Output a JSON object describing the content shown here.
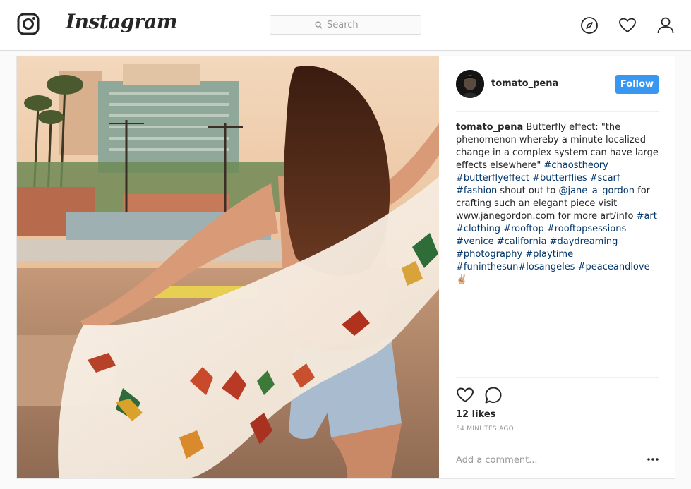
{
  "nav": {
    "brand": "Instagram",
    "search_placeholder": "Search",
    "icons": [
      "instagram-logo-icon",
      "explore-compass-icon",
      "activity-heart-icon",
      "profile-person-icon"
    ]
  },
  "post": {
    "author": "tomato_pena",
    "follow_label": "Follow",
    "caption_username": "tomato_pena",
    "caption_parts": [
      {
        "t": " Butterfly effect: \"the phenomenon whereby a minute localized change in a complex system can have large effects elsewhere\" ",
        "k": "text"
      },
      {
        "t": "#chaostheory",
        "k": "tag"
      },
      {
        "t": " ",
        "k": "text"
      },
      {
        "t": "#butterflyeffect",
        "k": "tag"
      },
      {
        "t": " ",
        "k": "text"
      },
      {
        "t": "#butterflies",
        "k": "tag"
      },
      {
        "t": " ",
        "k": "text"
      },
      {
        "t": "#scarf",
        "k": "tag"
      },
      {
        "t": " ",
        "k": "text"
      },
      {
        "t": "#fashion",
        "k": "tag"
      },
      {
        "t": " shout out to ",
        "k": "text"
      },
      {
        "t": "@jane_a_gordon",
        "k": "tag"
      },
      {
        "t": " for crafting such an elegant piece visit www.janegordon.com for more art/info ",
        "k": "text"
      },
      {
        "t": "#art",
        "k": "tag"
      },
      {
        "t": " ",
        "k": "text"
      },
      {
        "t": "#clothing",
        "k": "tag"
      },
      {
        "t": " ",
        "k": "text"
      },
      {
        "t": "#rooftop",
        "k": "tag"
      },
      {
        "t": " ",
        "k": "text"
      },
      {
        "t": "#rooftopsessions",
        "k": "tag"
      },
      {
        "t": " ",
        "k": "text"
      },
      {
        "t": "#venice",
        "k": "tag"
      },
      {
        "t": " ",
        "k": "text"
      },
      {
        "t": "#california",
        "k": "tag"
      },
      {
        "t": " ",
        "k": "text"
      },
      {
        "t": "#daydreaming",
        "k": "tag"
      },
      {
        "t": " ",
        "k": "text"
      },
      {
        "t": "#photography",
        "k": "tag"
      },
      {
        "t": " ",
        "k": "text"
      },
      {
        "t": "#playtime",
        "k": "tag"
      },
      {
        "t": " ",
        "k": "text"
      },
      {
        "t": "#funinthesun",
        "k": "tag"
      },
      {
        "t": "#losangeles",
        "k": "tag"
      },
      {
        "t": " ",
        "k": "text"
      },
      {
        "t": "#peaceandlove",
        "k": "tag"
      },
      {
        "t": " ✌🏼",
        "k": "text"
      }
    ],
    "likes": "12 likes",
    "timestamp": "54 MINUTES AGO",
    "comment_placeholder": "Add a comment...",
    "icons": [
      "like-heart-icon",
      "comment-bubble-icon",
      "more-options-icon"
    ]
  },
  "colors": {
    "follow_button": "#3897f0",
    "hashtag": "#003569",
    "border": "#dbdbdb",
    "muted_text": "#999999"
  }
}
